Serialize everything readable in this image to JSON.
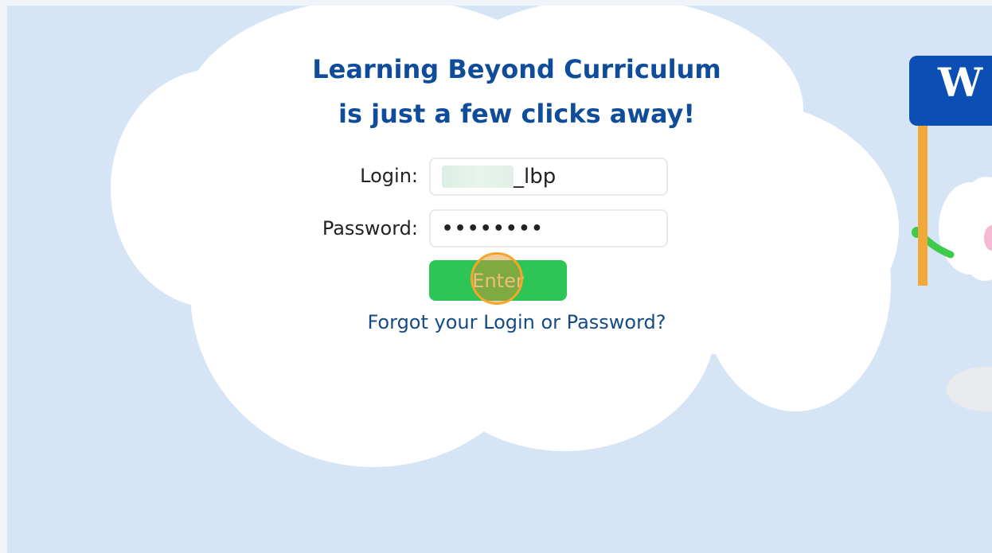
{
  "heading": {
    "line1": "Learning Beyond Curriculum",
    "line2": "is just a few clicks away!"
  },
  "form": {
    "login_label": "Login:",
    "login_value": "_lbp",
    "password_label": "Password:",
    "password_value": "••••••••",
    "enter_label": "Enter",
    "forgot_link": "Forgot your Login or Password?"
  },
  "sign": {
    "visible_text": "W"
  },
  "colors": {
    "background": "#d5e5f5",
    "heading": "#0f4c9a",
    "enter_button": "#2dc656",
    "link": "#144b86",
    "sign": "#0b4fb5"
  }
}
